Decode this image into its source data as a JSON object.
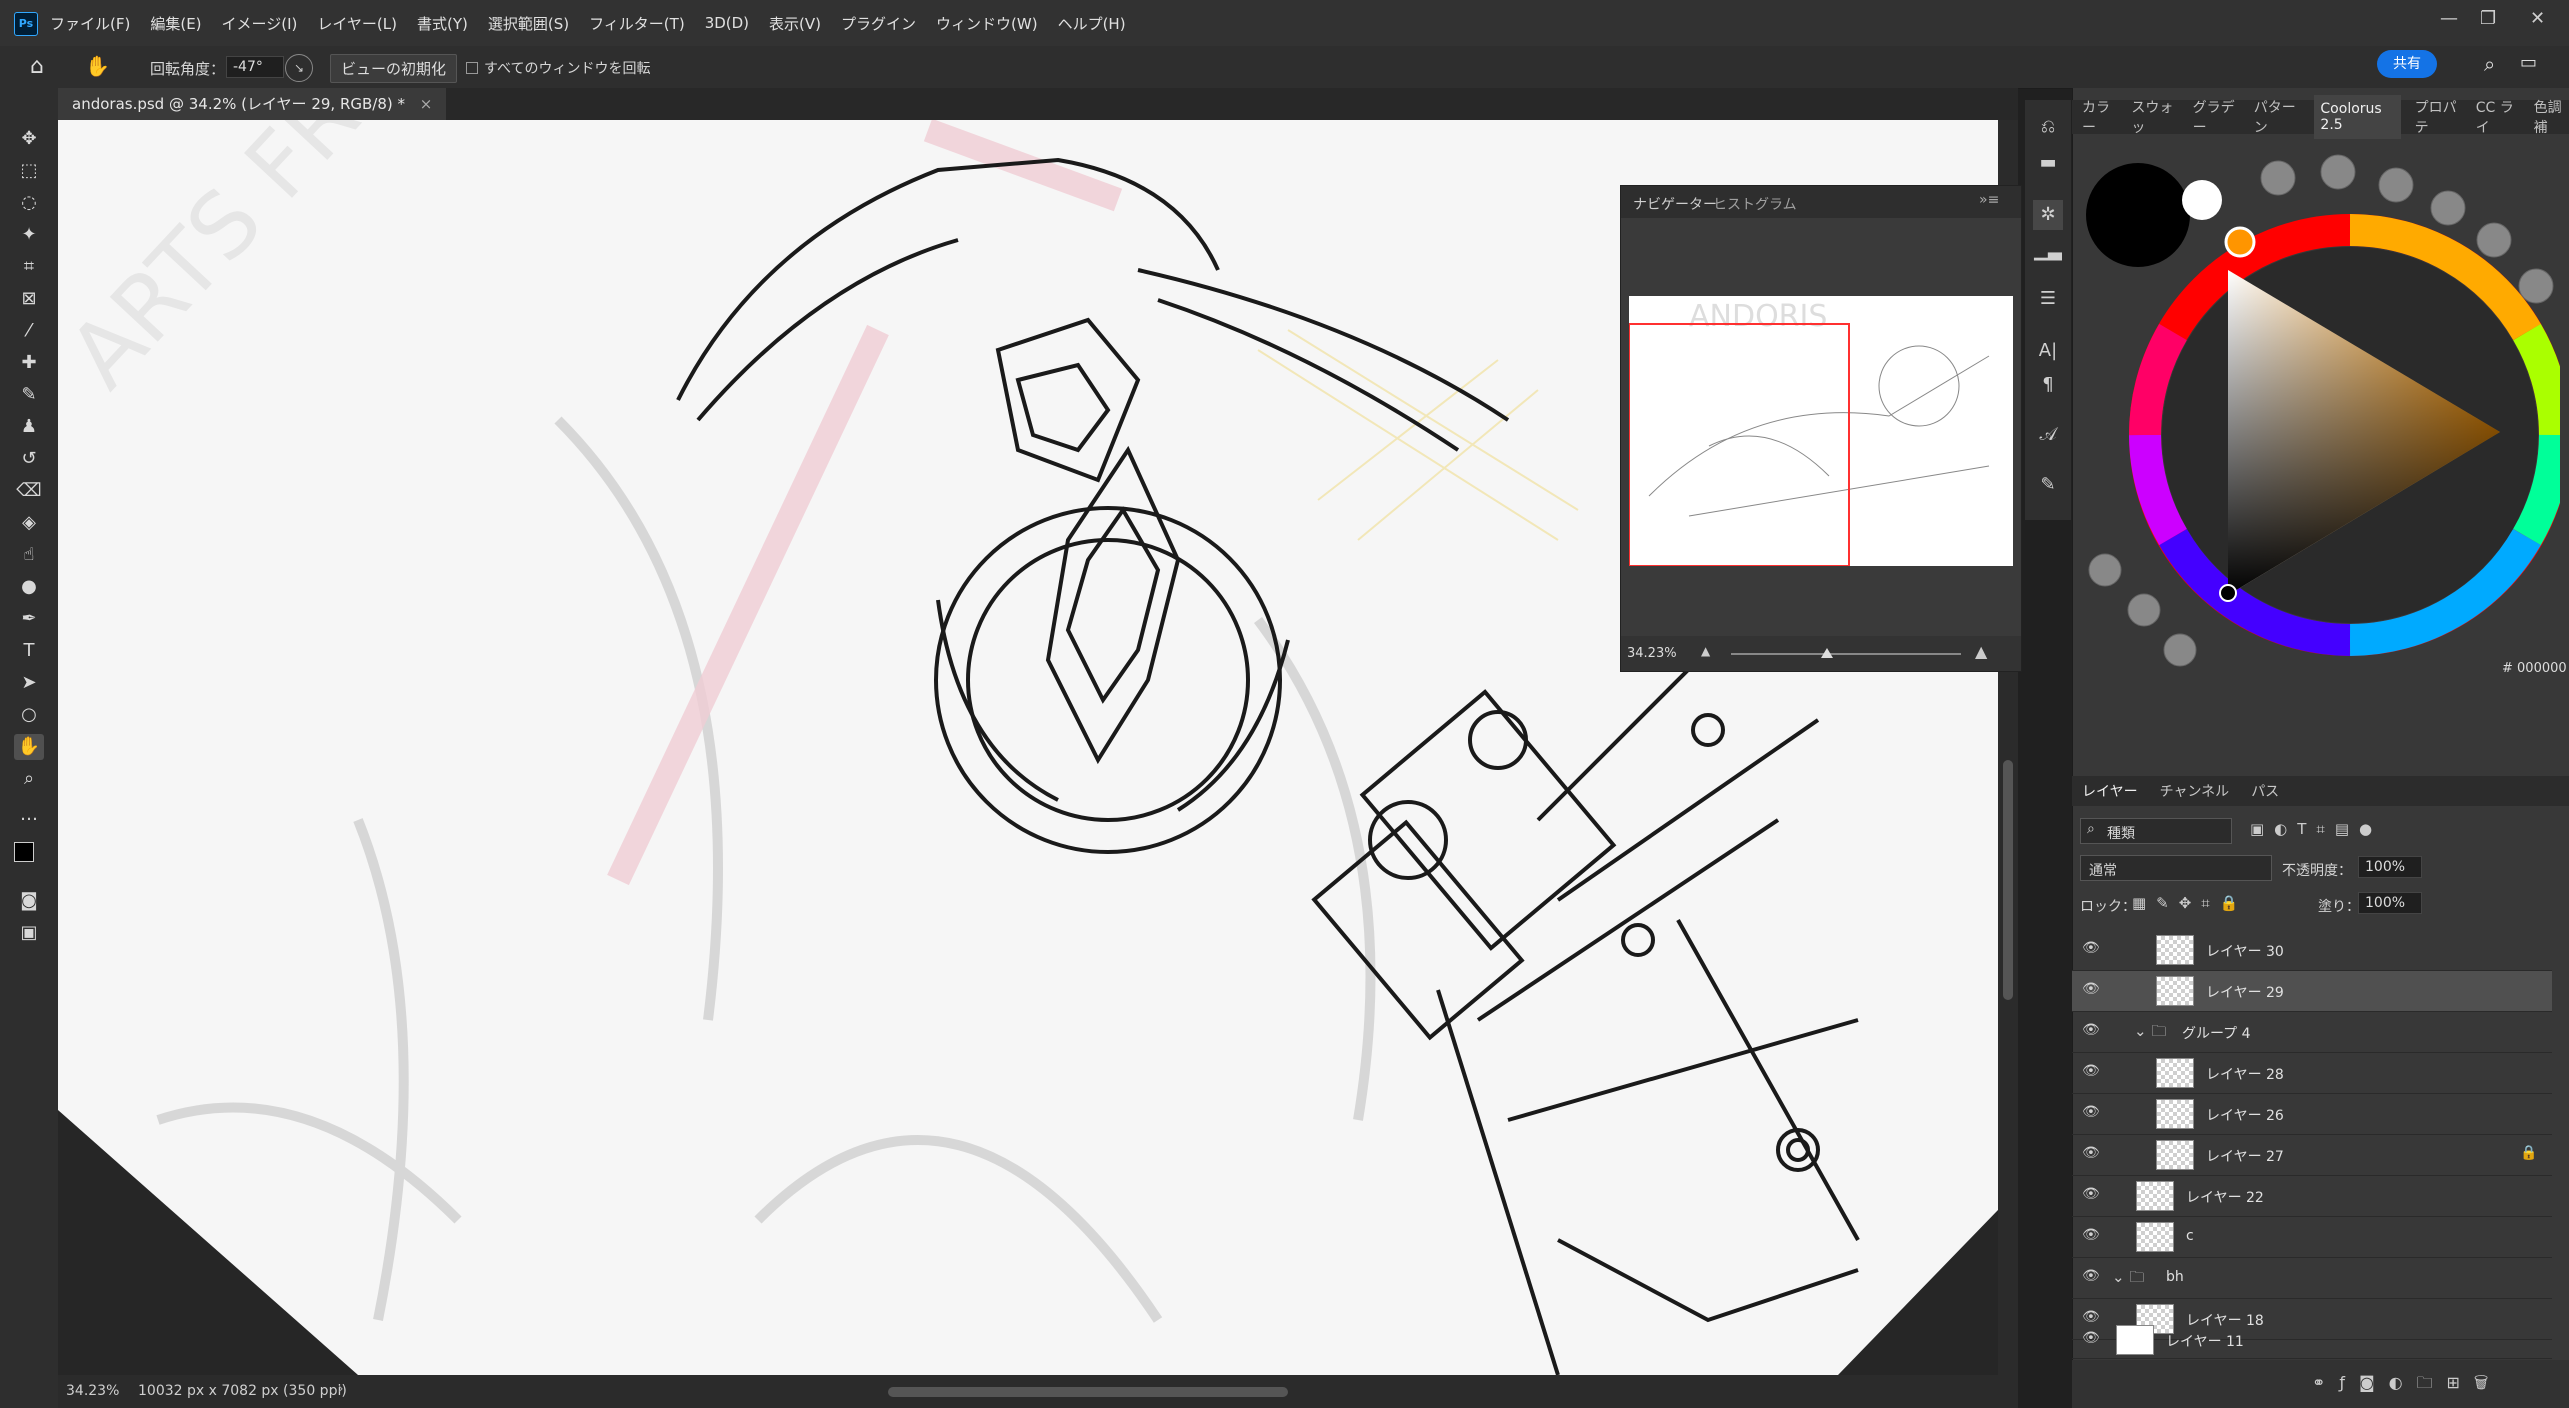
{
  "app": {
    "logo": "Ps"
  },
  "menu": [
    "ファイル(F)",
    "編集(E)",
    "イメージ(I)",
    "レイヤー(L)",
    "書式(Y)",
    "選択範囲(S)",
    "フィルター(T)",
    "3D(D)",
    "表示(V)",
    "プラグイン",
    "ウィンドウ(W)",
    "ヘルプ(H)"
  ],
  "window_controls": {
    "minimize": "—",
    "restore": "❐",
    "close": "✕"
  },
  "options": {
    "rotate_label": "回転角度：",
    "rotate_value": "-47°",
    "reset_view": "ビューの初期化",
    "rotate_all": "すべてのウィンドウを回転",
    "share": "共有"
  },
  "document": {
    "tab_title": "andoras.psd @ 34.2% (レイヤー 29, RGB/8) *",
    "close": "×"
  },
  "status": {
    "zoom": "34.23%",
    "info": "10032 px x 7082 px (350 ppi)"
  },
  "navigator": {
    "tabs": [
      "ナビゲーター",
      "ヒストグラム"
    ],
    "preview_title": "ANDORIS",
    "zoom": "34.23%"
  },
  "color_panel": {
    "tabs": [
      "カラー",
      "スウォッ",
      "グラデー",
      "パターン",
      "Coolorus 2.5",
      "プロパテ",
      "CC ライ",
      "色調補"
    ],
    "active_tab": "Coolorus 2.5",
    "hex": "# 000000",
    "foreground": "#000000",
    "background": "#ffffff",
    "picked": "#ff9500"
  },
  "layers_panel": {
    "tabs": [
      "レイヤー",
      "チャンネル",
      "パス"
    ],
    "filter": "種類",
    "blend_mode": "通常",
    "opacity_label": "不透明度：",
    "opacity": "100%",
    "lock_label": "ロック：",
    "fill_label": "塗り：",
    "fill": "100%",
    "layers": [
      {
        "name": "レイヤー 30",
        "indent": 2,
        "type": "layer"
      },
      {
        "name": "レイヤー 29",
        "indent": 2,
        "type": "layer",
        "selected": true
      },
      {
        "name": "グループ 4",
        "indent": 1,
        "type": "group"
      },
      {
        "name": "レイヤー 28",
        "indent": 2,
        "type": "layer"
      },
      {
        "name": "レイヤー 26",
        "indent": 2,
        "type": "layer"
      },
      {
        "name": "レイヤー 27",
        "indent": 2,
        "type": "layer",
        "locked": true
      },
      {
        "name": "レイヤー 22",
        "indent": 1,
        "type": "layer"
      },
      {
        "name": "c",
        "indent": 1,
        "type": "layer"
      },
      {
        "name": "bh",
        "indent": 0,
        "type": "group"
      },
      {
        "name": "レイヤー 18",
        "indent": 1,
        "type": "layer"
      },
      {
        "name": "レイヤー 11",
        "indent": 0,
        "type": "white"
      }
    ]
  },
  "layer_footer": [
    "link-icon",
    "fx-icon",
    "mask-icon",
    "adjustment-icon",
    "folder-icon",
    "new-layer-icon",
    "trash-icon"
  ]
}
